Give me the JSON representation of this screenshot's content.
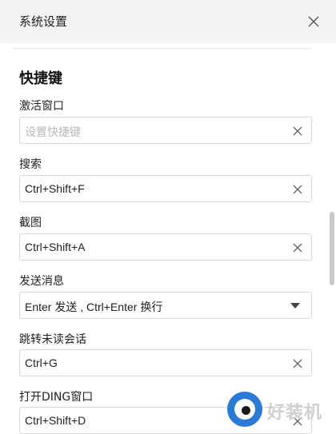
{
  "window": {
    "title": "系统设置"
  },
  "section": {
    "title": "快捷键"
  },
  "shortcuts": [
    {
      "label": "激活窗口",
      "value": "",
      "placeholder": "设置快捷键"
    },
    {
      "label": "搜索",
      "value": "Ctrl+Shift+F"
    },
    {
      "label": "截图",
      "value": "Ctrl+Shift+A"
    },
    {
      "label": "发送消息",
      "value": "Enter 发送 , Ctrl+Enter 换行"
    },
    {
      "label": "跳转未读会话",
      "value": "Ctrl+G"
    },
    {
      "label": "打开DING窗口",
      "value": "Ctrl+Shift+D"
    }
  ],
  "watermark": {
    "text": "好装机"
  },
  "icons": {
    "close": "close-icon",
    "clear": "clear-icon",
    "dropdown": "caret-down-icon"
  }
}
